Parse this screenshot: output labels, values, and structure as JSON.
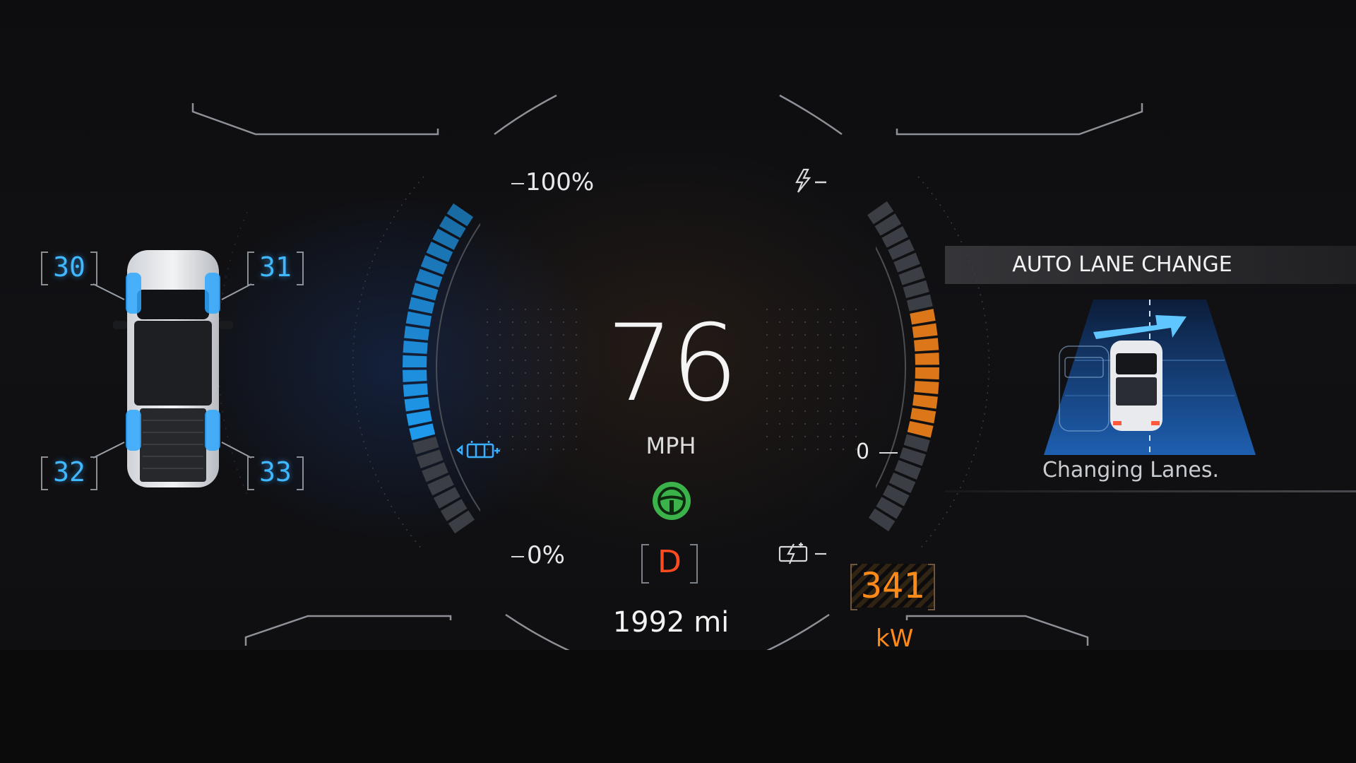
{
  "tire_pressure": {
    "front_left": "30",
    "front_right": "31",
    "rear_left": "32",
    "rear_right": "33"
  },
  "battery_gauge": {
    "top_label": "100%",
    "bottom_label": "0%",
    "level_fraction": 0.7
  },
  "speedometer": {
    "speed": "76",
    "unit": "MPH"
  },
  "drive": {
    "gear": "D",
    "odometer": "1992 mi"
  },
  "power_gauge": {
    "zero_label": "0",
    "value": "341",
    "unit": "kW",
    "level_fraction": 0.55
  },
  "auto_lane_change": {
    "title": "AUTO LANE CHANGE",
    "status": "Changing Lanes."
  },
  "colors": {
    "tpms": "#3fb8ff",
    "battery_fill": "#1f9cf0",
    "power_fill": "#ff8a1a",
    "gear": "#ff4b1f",
    "steering_indicator": "#3bb34a"
  },
  "icons": {
    "power_gauge_top": "lightning-icon",
    "battery_gauge_side": "battery-icon",
    "regen_gauge_bottom": "regen-charge-icon",
    "driver_assist": "steering-wheel-icon"
  }
}
